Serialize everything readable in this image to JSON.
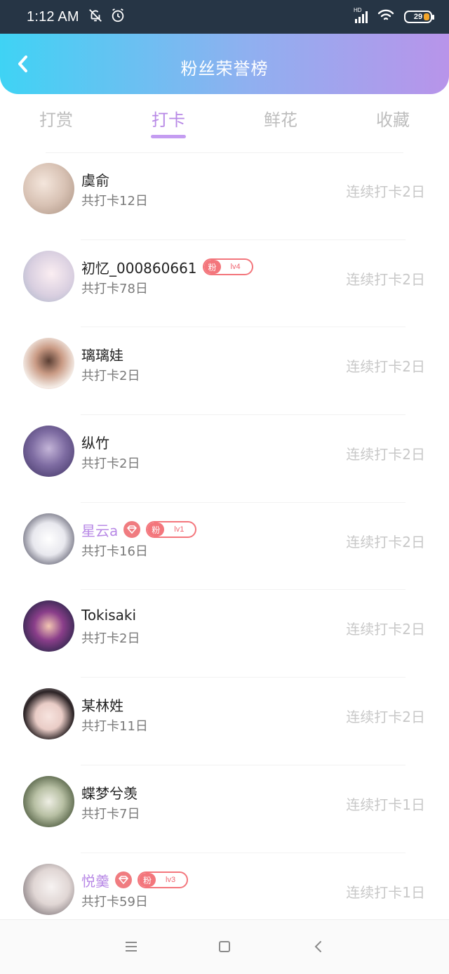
{
  "status": {
    "time": "1:12 AM",
    "battery": "29",
    "hd_label": "HD"
  },
  "header": {
    "title": "粉丝荣誉榜"
  },
  "tabs": [
    {
      "label": "打赏"
    },
    {
      "label": "打卡"
    },
    {
      "label": "鲜花"
    },
    {
      "label": "收藏"
    }
  ],
  "colors": {
    "accent": "#b889e6",
    "badge": "#f3767c",
    "header_start": "#3fd3f4",
    "header_end": "#b894ea"
  },
  "list": [
    {
      "name": "虞俞",
      "total": "共打卡12日",
      "streak": "连续打卡2日"
    },
    {
      "name": "初忆_000860661",
      "total": "共打卡78日",
      "streak": "连续打卡2日",
      "fan_label": "粉",
      "level": "lv4"
    },
    {
      "name": "璃璃娃",
      "total": "共打卡2日",
      "streak": "连续打卡2日"
    },
    {
      "name": "纵竹",
      "total": "共打卡2日",
      "streak": "连续打卡2日"
    },
    {
      "name": "星云a",
      "total": "共打卡16日",
      "streak": "连续打卡2日",
      "fan_label": "粉",
      "level": "lv1"
    },
    {
      "name": "Tokisaki",
      "total": "共打卡2日",
      "streak": "连续打卡2日"
    },
    {
      "name": "某林姓",
      "total": "共打卡11日",
      "streak": "连续打卡2日"
    },
    {
      "name": "蝶梦兮羡",
      "total": "共打卡7日",
      "streak": "连续打卡1日"
    },
    {
      "name": "悦羹",
      "total": "共打卡59日",
      "streak": "连续打卡1日",
      "fan_label": "粉",
      "level": "lv3"
    }
  ]
}
